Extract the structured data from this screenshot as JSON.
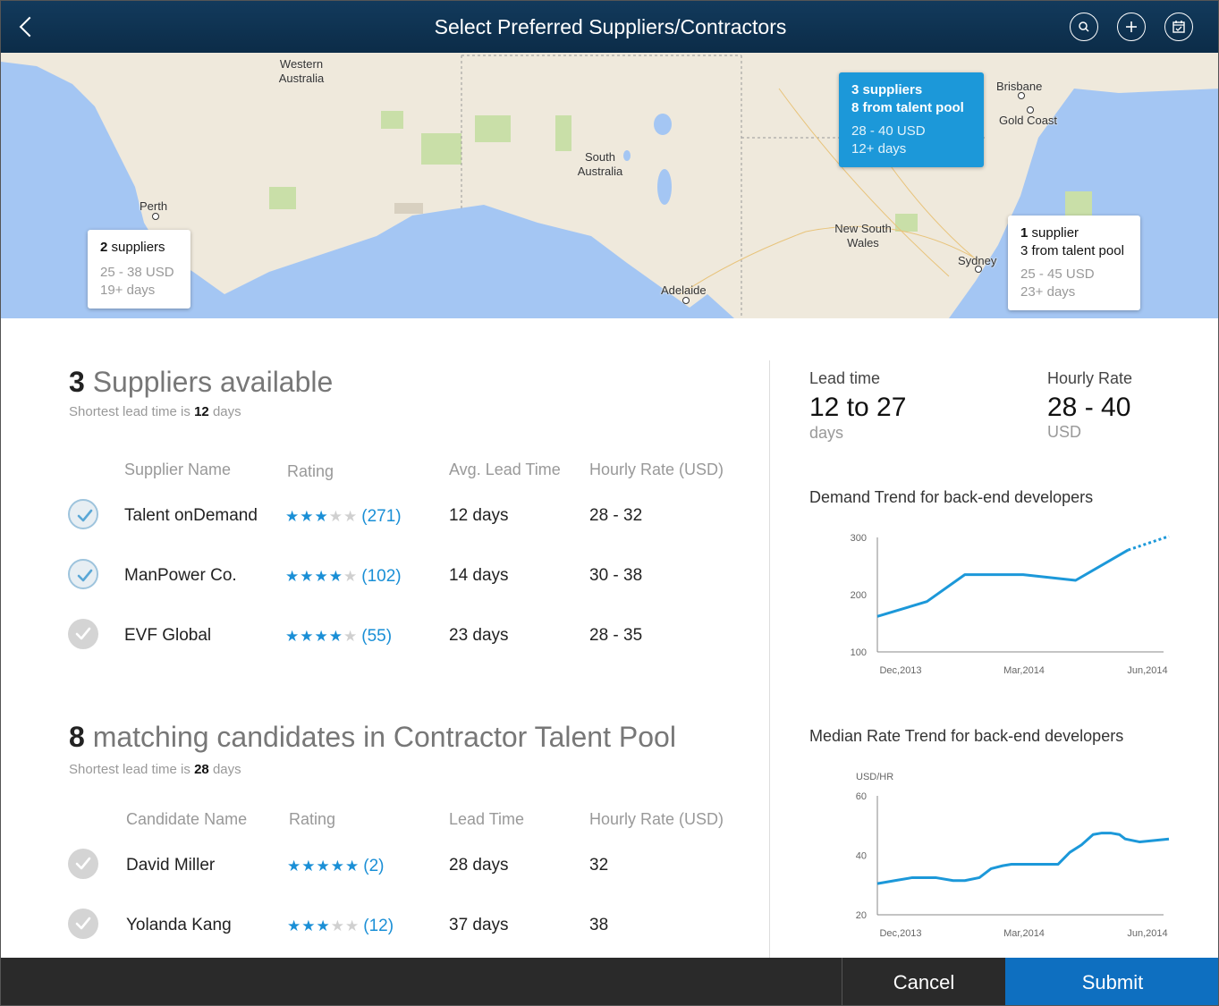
{
  "header": {
    "title": "Select Preferred Suppliers/Contractors"
  },
  "map": {
    "regions": [
      "Western Australia",
      "South Australia",
      "New South Wales"
    ],
    "cities": [
      "Perth",
      "Adelaide",
      "Sydney",
      "Brisbane",
      "Gold Coast"
    ],
    "callouts": [
      {
        "count": "2",
        "line1": "suppliers",
        "line2": "",
        "rate": "25 - 38 USD",
        "days": "19+ days"
      },
      {
        "count": "3",
        "line1": "suppliers",
        "line2": "8 from talent pool",
        "rate": "28 - 40 USD",
        "days": "12+ days"
      },
      {
        "count": "1",
        "line1": "supplier",
        "line2": "3 from talent pool",
        "rate": "25 - 45 USD",
        "days": "23+ days"
      }
    ]
  },
  "suppliers": {
    "count": "3",
    "title": "Suppliers available",
    "sub_prefix": "Shortest lead time is",
    "sub_value": "12",
    "sub_suffix": "days",
    "columns": [
      "Supplier Name",
      "Rating",
      "Avg. Lead Time",
      "Hourly Rate (USD)"
    ],
    "rows": [
      {
        "name": "Talent onDemand",
        "stars": 3,
        "reviews": "(271)",
        "lead": "12 days",
        "rate": "28 - 32",
        "checked": true
      },
      {
        "name": "ManPower Co.",
        "stars": 4,
        "reviews": "(102)",
        "lead": "14 days",
        "rate": "30 - 38",
        "checked": true
      },
      {
        "name": "EVF Global",
        "stars": 4,
        "reviews": "(55)",
        "lead": "23 days",
        "rate": "28 - 35",
        "checked": false
      }
    ]
  },
  "talent": {
    "count": "8",
    "title": "matching candidates in Contractor Talent Pool",
    "sub_prefix": "Shortest lead time is",
    "sub_value": "28",
    "sub_suffix": "days",
    "columns": [
      "Candidate Name",
      "Rating",
      "Lead Time",
      "Hourly Rate (USD)"
    ],
    "rows": [
      {
        "name": "David Miller",
        "stars": 5,
        "reviews": "(2)",
        "lead": "28 days",
        "rate": "32",
        "checked": false
      },
      {
        "name": "Yolanda Kang",
        "stars": 3,
        "reviews": "(12)",
        "lead": "37 days",
        "rate": "38",
        "checked": false
      }
    ]
  },
  "summary": {
    "lead_label": "Lead time",
    "lead_value": "12 to 27",
    "lead_unit": "days",
    "rate_label": "Hourly Rate",
    "rate_value": "28 - 40",
    "rate_unit": "USD"
  },
  "colors": {
    "accent": "#1c98d9",
    "submit": "#0e6fc0",
    "header": "#0c2c48"
  },
  "chart_data": [
    {
      "type": "line",
      "title": "Demand Trend for back-end developers",
      "ylabel": "",
      "ylim": [
        100,
        300
      ],
      "yticks": [
        "300",
        "200",
        "100"
      ],
      "xticks": [
        "Dec,2013",
        "Mar,2014",
        "Jun,2014"
      ],
      "x": [
        0,
        0.17,
        0.3,
        0.5,
        0.68,
        0.86,
        1.0
      ],
      "values": [
        162,
        188,
        235,
        235,
        225,
        278,
        302
      ],
      "dotted_from_index": 5
    },
    {
      "type": "line",
      "title": "Median Rate Trend for back-end developers",
      "ylabel": "USD/HR",
      "ylim": [
        20,
        60
      ],
      "yticks": [
        "60",
        "40",
        "20"
      ],
      "xticks": [
        "Dec,2013",
        "Mar,2014",
        "Jun,2014"
      ],
      "x": [
        0,
        0.06,
        0.12,
        0.2,
        0.26,
        0.3,
        0.35,
        0.39,
        0.43,
        0.46,
        0.5,
        0.56,
        0.62,
        0.66,
        0.7,
        0.74,
        0.77,
        0.8,
        0.83,
        0.85,
        0.9,
        0.95,
        1.0
      ],
      "values": [
        30.5,
        31.5,
        32.5,
        32.5,
        31.5,
        31.5,
        32.5,
        35.5,
        36.5,
        37,
        37,
        37,
        37,
        41,
        43.5,
        47,
        47.5,
        47.5,
        47,
        45.5,
        44.5,
        45,
        45.5
      ]
    }
  ],
  "footer": {
    "cancel": "Cancel",
    "submit": "Submit"
  }
}
